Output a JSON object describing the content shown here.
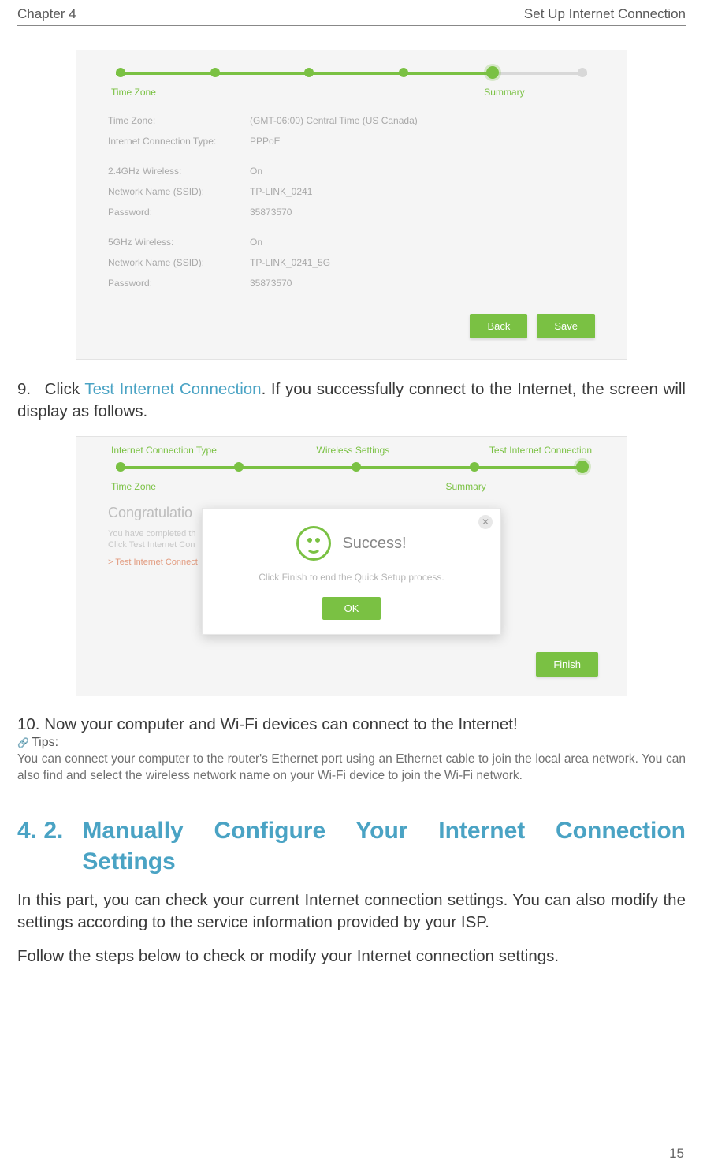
{
  "header": {
    "left": "Chapter 4",
    "right": "Set Up Internet Connection"
  },
  "screenshot1": {
    "progress_labels": {
      "left": "Time Zone",
      "right": "Summary"
    },
    "rows": [
      {
        "k": "Time Zone:",
        "v": "(GMT-06:00) Central Time (US Canada)"
      },
      {
        "k": "Internet Connection Type:",
        "v": "PPPoE"
      }
    ],
    "rows24": [
      {
        "k": "2.4GHz Wireless:",
        "v": "On"
      },
      {
        "k": "Network Name (SSID):",
        "v": "TP-LINK_0241"
      },
      {
        "k": "Password:",
        "v": "35873570"
      }
    ],
    "rows5": [
      {
        "k": "5GHz Wireless:",
        "v": "On"
      },
      {
        "k": "Network Name (SSID):",
        "v": "TP-LINK_0241_5G"
      },
      {
        "k": "Password:",
        "v": "35873570"
      }
    ],
    "buttons": {
      "back": "Back",
      "save": "Save"
    }
  },
  "step9": {
    "num": "9.",
    "pre": "Click ",
    "link": "Test Internet Connection",
    "post": ". If you successfully connect to the Internet, the screen will display as follows."
  },
  "screenshot2": {
    "top_labels": {
      "a": "Internet Connection Type",
      "b": "Wireless Settings",
      "c": "Test Internet Connection"
    },
    "progress_labels": {
      "left": "Time Zone",
      "right": "Summary"
    },
    "congrats": "Congratulatio",
    "line1": "You have completed th",
    "line2": "Click Test Internet Con",
    "linktext": "> Test Internet Connect",
    "finish": "Finish",
    "modal": {
      "title": "Success!",
      "sub": "Click Finish to end the Quick Setup process.",
      "ok": "OK"
    }
  },
  "step10": "10. Now your computer and Wi-Fi devices can connect to the Internet!",
  "tips": {
    "label": "Tips:",
    "body": "You can connect your computer to the router's Ethernet port using an Ethernet cable to join the local area network. You can also find and select the wireless network name on your Wi-Fi device to join the Wi-Fi network."
  },
  "section": {
    "num": "4. 2.",
    "title": "Manually Configure Your Internet Connection Settings"
  },
  "para1": "In this part, you can check your current Internet connection settings. You can also modify the settings according to the service information provided by your ISP.",
  "para2": "Follow the steps below to check or modify your Internet connection settings.",
  "page_number": "15"
}
